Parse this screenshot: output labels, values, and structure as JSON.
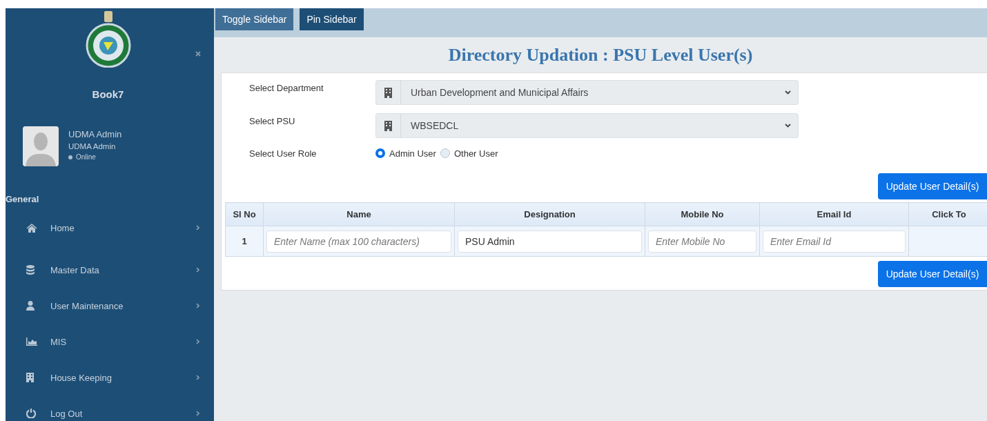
{
  "sidebar": {
    "brand": "Book7",
    "user": {
      "name": "UDMA Admin",
      "role": "UDMA Admin",
      "status": "Online"
    },
    "section": "General",
    "items": [
      {
        "label": "Home"
      },
      {
        "label": "Master Data"
      },
      {
        "label": "User Maintenance"
      },
      {
        "label": "MIS"
      },
      {
        "label": "House Keeping"
      },
      {
        "label": "Log Out"
      }
    ]
  },
  "toolbar": {
    "buttons": [
      {
        "label": "Toggle Sidebar",
        "selected": false
      },
      {
        "label": "Pin Sidebar",
        "selected": true
      }
    ]
  },
  "page_title": "Directory Updation : PSU Level User(s)",
  "form": {
    "department": {
      "label": "Select Department",
      "value": "Urban Development and Municipal Affairs"
    },
    "psu": {
      "label": "Select PSU",
      "value": "WBSEDCL"
    },
    "user_role": {
      "label": "Select User Role",
      "options": [
        {
          "label": "Admin User",
          "selected": true
        },
        {
          "label": "Other User",
          "selected": false
        }
      ]
    }
  },
  "update_button_top": "Update User Detail(s)",
  "table": {
    "columns": [
      "Sl No",
      "Name",
      "Designation",
      "Mobile No",
      "Email Id",
      "Click To"
    ],
    "rows": [
      {
        "sl_no": "1",
        "name": {
          "placeholder": "Enter Name (max 100 characters)"
        },
        "designation": {
          "value": "PSU Admin"
        },
        "mobile_no": {
          "placeholder": "Enter Mobile No"
        },
        "email_id": {
          "placeholder": "Enter Email Id"
        }
      }
    ]
  },
  "update_button_bottom": "Update User Detail(s)"
}
